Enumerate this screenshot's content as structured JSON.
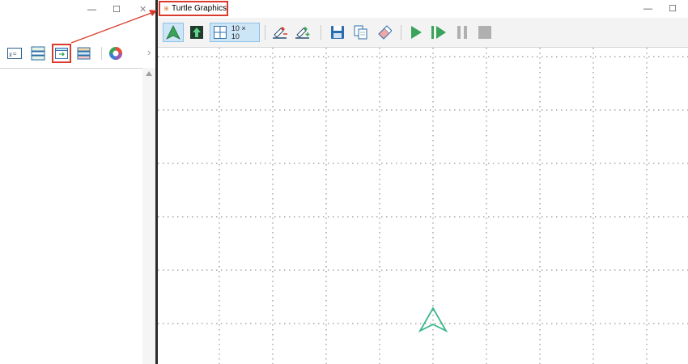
{
  "left_window": {
    "controls": {
      "minimize": "—",
      "maximize": "☐",
      "close": "✕"
    },
    "toolbar_icons": [
      "variables-icon",
      "list-icon",
      "turtle-graphics-icon",
      "stack-icon",
      "color-wheel-icon"
    ],
    "highlight_color": "#d93a2b"
  },
  "right_window": {
    "title": "Turtle Graphics",
    "controls": {
      "minimize": "—",
      "maximize": "☐"
    },
    "toolbar": {
      "grid_label": "10 × 10",
      "icons": [
        "turtle-icon",
        "turtle-up-icon",
        "grid-icon",
        "pen-up-icon",
        "pen-down-icon",
        "save-icon",
        "copy-icon",
        "clear-icon",
        "run-icon",
        "step-icon",
        "pause-icon",
        "stop-icon"
      ]
    },
    "canvas": {
      "grid": "dotted",
      "turtle_color": "#3cb88a"
    }
  },
  "colors": {
    "accent": "#2e8bd6",
    "run_green": "#3aa35a",
    "annotation_red": "#d93a2b"
  }
}
